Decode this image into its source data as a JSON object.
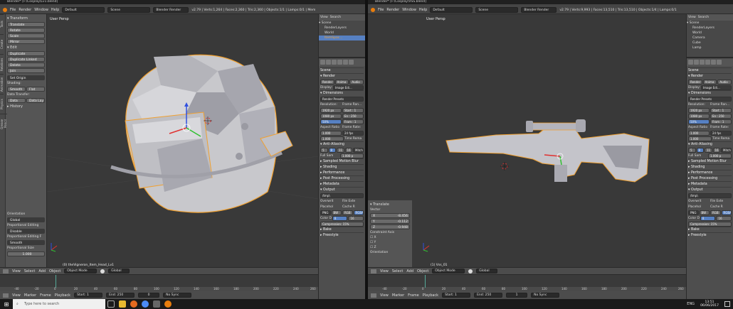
{
  "left": {
    "title": "Blender* [F:\\Cosplay\\Lv1.blend]",
    "menus": [
      "File",
      "Render",
      "Window",
      "Help"
    ],
    "layout": "Default",
    "scene": "Scene",
    "engine": "Blender Render",
    "stats": "v2.79 | Verts:1,264 | Faces:2,360 | Tris:2,360 | Objects:1/1 | Lamps:0/1 | Mem",
    "tool_tabs": [
      "Tools",
      "Create",
      "Relations",
      "Animation",
      "Physics",
      "Grease Pencil"
    ],
    "transform_header": "Transform",
    "transform_buttons": [
      "Translate",
      "Rotate",
      "Scale",
      "Mirror"
    ],
    "edit_header": "Edit",
    "edit_buttons": [
      "Duplicate",
      "Duplicate Linked",
      "Delete",
      "Join"
    ],
    "set_origin": "Set Origin",
    "shading_label": "Shading:",
    "shading_buttons": [
      "Smooth",
      "Flat"
    ],
    "data_transfer_label": "Data Transfer:",
    "data_buttons": [
      "Data",
      "Data Lay"
    ],
    "history_header": "History",
    "orientation_label": "Orientation",
    "orientation_value": "Global",
    "prop_edit_label": "Proportional Editing",
    "prop_edit_value": "Disable",
    "prop_falloff_label": "Proportional Editing F",
    "prop_falloff_value": "Smooth",
    "prop_size_label": "Proportional Size",
    "prop_size_value": "1.000",
    "view_label": "User Persp",
    "object_label": "(0) theVigneron_Item_Head_Lv1",
    "header": [
      "View",
      "Select",
      "Add",
      "Object"
    ],
    "mode": "Object Mode",
    "pivot": "Global",
    "timeline_ticks": [
      "-40",
      "-20",
      "0",
      "20",
      "40",
      "60",
      "80",
      "100",
      "120",
      "140",
      "160",
      "180",
      "200",
      "220",
      "240",
      "260"
    ],
    "timeline_footer": [
      "View",
      "Marker",
      "Frame",
      "Playback"
    ],
    "start": "Start:",
    "start_val": "1",
    "end": "End:",
    "end_val": "250",
    "frame_val": "0",
    "sync": "No Sync"
  },
  "left_props": {
    "outliner": [
      "Scene",
      "RenderLayers",
      "World",
      "ItemSpac..."
    ],
    "scene_label": "Scene",
    "render_header": "Render",
    "render_buttons": [
      "Render",
      "Anima",
      "Audio"
    ],
    "display_label": "Display:",
    "display_value": "Image Edi...",
    "dimensions_header": "Dimensions",
    "render_presets": "Render Presets",
    "resolution_label": "Resolution:",
    "frame_range_label": "Frame Ran...",
    "res_x": "1920 px",
    "res_y": "1080 px",
    "res_pct": "50%",
    "start_f": "Start : 1",
    "end_f": "En : 250",
    "fram_f": "Fram : 1",
    "aspect_label": "Aspect Ratio",
    "fr_label": "Frame Rate:",
    "asp_x": "1.000",
    "asp_y": "1.000",
    "fps": "24 fps",
    "time_remap": "Time Rema",
    "aa_header": "Anti-Aliasing",
    "aa_vals": [
      "5",
      "8",
      "11",
      "16"
    ],
    "aa_filter": "Mitchell-...",
    "full_sample": "Full Sam",
    "aa_size": "1.000 p",
    "sections": [
      "Sampled Motion Blur",
      "Shading",
      "Performance",
      "Post Processing",
      "Metadata",
      "Output"
    ],
    "output_path": "/tmp\\",
    "overwrite": "Overwrit",
    "file_ext": "File Exte",
    "placeholders": "Placehol",
    "cache_result": "Cache R",
    "format": "PNG",
    "bw": "BW",
    "rgb": "RGB",
    "rgba": "RGBA",
    "color_depth": "Color D",
    "depth8": "8",
    "depth16": "16",
    "compression": "Compression:",
    "compression_val": "15%",
    "bake": "Bake",
    "freestyle": "Freestyle"
  },
  "right": {
    "title": "Blender* [F:\\Cosplay\\VSS.blend]",
    "menus": [
      "File",
      "Render",
      "Window",
      "Help"
    ],
    "layout": "Default",
    "scene": "Scene",
    "engine": "Blender Render",
    "stats": "v2.79 | Verts:9,993 | Faces:13,510 | Tris:13,510 | Objects:1/4 | Lamps:0/1",
    "view_label": "User Persp",
    "object_label": "(1) Vss_01",
    "translate_header": "Translate",
    "vector_label": "Vector",
    "vx": "X",
    "vx_val": "-8.456",
    "vy": "Y",
    "vy_val": "-0.112",
    "vz": "Z",
    "vz_val": "-0.948",
    "constraint_label": "Constraint Axis",
    "constraint_axes": [
      "X",
      "Y",
      "Z"
    ],
    "orientation": "Orientation",
    "header": [
      "View",
      "Select",
      "Add",
      "Object"
    ],
    "mode": "Object Mode",
    "pivot": "Global",
    "timeline_ticks": [
      "-40",
      "-20",
      "0",
      "20",
      "40",
      "60",
      "80",
      "100",
      "120",
      "140",
      "160",
      "180",
      "200",
      "220",
      "240",
      "260"
    ],
    "timeline_footer": [
      "View",
      "Marker",
      "Frame",
      "Playback"
    ],
    "start": "Start:",
    "start_val": "1",
    "end": "End:",
    "end_val": "250",
    "frame_val": "1",
    "sync": "No Sync"
  },
  "right_props": {
    "outliner": [
      "Scene",
      "RenderLayers",
      "World",
      "Camera",
      "Cube",
      "Lamp"
    ],
    "scene_label": "Scene",
    "render_header": "Render",
    "render_buttons": [
      "Render",
      "Anima",
      "Audio"
    ],
    "display_label": "Display:",
    "display_value": "Image Edi...",
    "dimensions_header": "Dimensions",
    "render_presets": "Render Presets",
    "resolution_label": "Resolution:",
    "frame_range_label": "Frame Ran...",
    "res_x": "1920 px",
    "res_y": "1080 px",
    "res_pct": "50%",
    "start_f": "Start : 1",
    "end_f": "En : 250",
    "fram_f": "Fram : 1",
    "aspect_label": "Aspect Ratio",
    "fr_label": "Frame Rate:",
    "asp_x": "1.000",
    "asp_y": "1.000",
    "fps": "24 fps",
    "time_remap": "Time Rema",
    "aa_header": "Anti-Aliasing",
    "aa_vals": [
      "5",
      "8",
      "11",
      "16"
    ],
    "aa_filter": "Mitchell-...",
    "full_sample": "Full Sam",
    "aa_size": "1.000 p",
    "sections": [
      "Sampled Motion Blur",
      "Shading",
      "Performance",
      "Post Processing",
      "Metadata",
      "Output"
    ],
    "output_path": "/tmp\\",
    "overwrite": "Overwrit",
    "file_ext": "File Exte",
    "placeholders": "Placehol",
    "cache_result": "Cache R",
    "format": "PNG",
    "bw": "BW",
    "rgb": "RGB",
    "rgba": "RGBA",
    "color_depth": "Color D",
    "depth8": "8",
    "depth16": "16",
    "compression": "Compression:",
    "compression_val": "15%",
    "bake": "Bake",
    "freestyle": "Freestyle"
  },
  "taskbar": {
    "search_placeholder": "Type here to search",
    "time": "13:51",
    "date": "06/06/2017",
    "lang": "ENG"
  },
  "colors": {
    "selected_orange": "#f0a030",
    "axis_red": "#e03030",
    "axis_green": "#30c030",
    "axis_blue": "#3050e0",
    "active_blue": "#5680c2"
  }
}
